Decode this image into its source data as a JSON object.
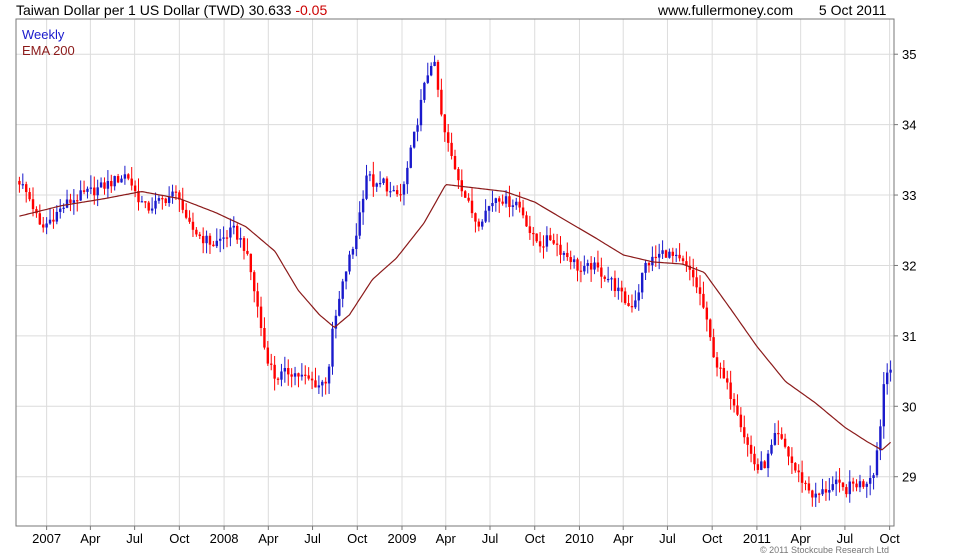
{
  "header": {
    "title": "Taiwan Dollar per 1 US Dollar (TWD)",
    "last_value": "30.633",
    "change": "-0.05",
    "site": "www.fullermoney.com",
    "date": "5 Oct 2011"
  },
  "legend": {
    "weekly": "Weekly",
    "ema": "EMA 200"
  },
  "copyright": "© 2011 Stockcube Research Ltd",
  "colors": {
    "up": "#1a1acc",
    "down": "#ff0000",
    "ema": "#8b1a1a",
    "grid": "#dcdcdc",
    "frame": "#777777"
  },
  "chart_data": {
    "type": "line",
    "title": "Taiwan Dollar per 1 US Dollar (TWD)",
    "frequency": "Weekly",
    "ylim": [
      28.3,
      35.5
    ],
    "y_ticks": [
      29,
      30,
      31,
      32,
      33,
      34,
      35
    ],
    "x_range": [
      "2006-10-30",
      "2011-10-10"
    ],
    "x_ticks": [
      {
        "label": "2007",
        "date": "2007-01-01"
      },
      {
        "label": "Apr",
        "date": "2007-04-01"
      },
      {
        "label": "Jul",
        "date": "2007-07-01"
      },
      {
        "label": "Oct",
        "date": "2007-10-01"
      },
      {
        "label": "2008",
        "date": "2008-01-01"
      },
      {
        "label": "Apr",
        "date": "2008-04-01"
      },
      {
        "label": "Jul",
        "date": "2008-07-01"
      },
      {
        "label": "Oct",
        "date": "2008-10-01"
      },
      {
        "label": "2009",
        "date": "2009-01-01"
      },
      {
        "label": "Apr",
        "date": "2009-04-01"
      },
      {
        "label": "Jul",
        "date": "2009-07-01"
      },
      {
        "label": "Oct",
        "date": "2009-10-01"
      },
      {
        "label": "2010",
        "date": "2010-01-01"
      },
      {
        "label": "Apr",
        "date": "2010-04-01"
      },
      {
        "label": "Jul",
        "date": "2010-07-01"
      },
      {
        "label": "Oct",
        "date": "2010-10-01"
      },
      {
        "label": "2011",
        "date": "2011-01-01"
      },
      {
        "label": "Apr",
        "date": "2011-04-01"
      },
      {
        "label": "Jul",
        "date": "2011-07-01"
      },
      {
        "label": "Oct",
        "date": "2011-10-01"
      }
    ],
    "series": [
      {
        "name": "Weekly",
        "style": "candles",
        "points": [
          [
            "2006-11-06",
            33.2
          ],
          [
            "2006-12-01",
            32.9
          ],
          [
            "2006-12-20",
            32.5
          ],
          [
            "2007-01-15",
            32.7
          ],
          [
            "2007-02-15",
            32.9
          ],
          [
            "2007-03-15",
            33.0
          ],
          [
            "2007-04-20",
            33.1
          ],
          [
            "2007-05-20",
            33.2
          ],
          [
            "2007-06-15",
            33.3
          ],
          [
            "2007-07-05",
            33.0
          ],
          [
            "2007-07-25",
            32.8
          ],
          [
            "2007-08-20",
            32.9
          ],
          [
            "2007-09-15",
            33.0
          ],
          [
            "2007-10-01",
            33.0
          ],
          [
            "2007-10-15",
            32.6
          ],
          [
            "2007-11-15",
            32.4
          ],
          [
            "2007-12-10",
            32.3
          ],
          [
            "2008-01-01",
            32.4
          ],
          [
            "2008-01-20",
            32.5
          ],
          [
            "2008-02-10",
            32.3
          ],
          [
            "2008-02-25",
            31.9
          ],
          [
            "2008-03-10",
            31.4
          ],
          [
            "2008-03-25",
            30.8
          ],
          [
            "2008-04-15",
            30.4
          ],
          [
            "2008-05-15",
            30.5
          ],
          [
            "2008-06-15",
            30.4
          ],
          [
            "2008-07-15",
            30.3
          ],
          [
            "2008-08-01",
            30.4
          ],
          [
            "2008-08-10",
            31.0
          ],
          [
            "2008-08-25",
            31.5
          ],
          [
            "2008-09-10",
            32.0
          ],
          [
            "2008-09-25",
            32.3
          ],
          [
            "2008-10-05",
            32.7
          ],
          [
            "2008-10-20",
            33.3
          ],
          [
            "2008-11-10",
            33.1
          ],
          [
            "2008-11-25",
            33.2
          ],
          [
            "2008-12-10",
            33.0
          ],
          [
            "2009-01-01",
            33.0
          ],
          [
            "2009-01-25",
            33.8
          ],
          [
            "2009-02-15",
            34.5
          ],
          [
            "2009-03-01",
            34.9
          ],
          [
            "2009-03-10",
            34.8
          ],
          [
            "2009-03-25",
            34.0
          ],
          [
            "2009-04-10",
            33.6
          ],
          [
            "2009-04-25",
            33.3
          ],
          [
            "2009-05-15",
            32.9
          ],
          [
            "2009-06-05",
            32.6
          ],
          [
            "2009-06-25",
            32.8
          ],
          [
            "2009-07-15",
            33.0
          ],
          [
            "2009-08-05",
            32.9
          ],
          [
            "2009-08-25",
            32.9
          ],
          [
            "2009-09-10",
            32.7
          ],
          [
            "2009-09-25",
            32.4
          ],
          [
            "2009-10-15",
            32.3
          ],
          [
            "2009-11-05",
            32.4
          ],
          [
            "2009-11-25",
            32.2
          ],
          [
            "2009-12-15",
            32.1
          ],
          [
            "2010-01-05",
            31.9
          ],
          [
            "2010-01-25",
            32.0
          ],
          [
            "2010-02-15",
            31.9
          ],
          [
            "2010-03-05",
            31.8
          ],
          [
            "2010-03-25",
            31.6
          ],
          [
            "2010-04-15",
            31.4
          ],
          [
            "2010-05-01",
            31.6
          ],
          [
            "2010-05-15",
            32.0
          ],
          [
            "2010-06-05",
            32.1
          ],
          [
            "2010-06-25",
            32.2
          ],
          [
            "2010-07-15",
            32.1
          ],
          [
            "2010-08-05",
            32.0
          ],
          [
            "2010-08-25",
            31.8
          ],
          [
            "2010-09-10",
            31.5
          ],
          [
            "2010-09-25",
            31.0
          ],
          [
            "2010-10-10",
            30.6
          ],
          [
            "2010-10-30",
            30.3
          ],
          [
            "2010-11-20",
            30.0
          ],
          [
            "2010-12-10",
            29.5
          ],
          [
            "2011-01-01",
            29.1
          ],
          [
            "2011-01-20",
            29.2
          ],
          [
            "2011-02-10",
            29.6
          ],
          [
            "2011-03-01",
            29.4
          ],
          [
            "2011-03-20",
            29.1
          ],
          [
            "2011-04-10",
            28.9
          ],
          [
            "2011-04-30",
            28.7
          ],
          [
            "2011-05-20",
            28.8
          ],
          [
            "2011-06-10",
            28.9
          ],
          [
            "2011-06-30",
            28.8
          ],
          [
            "2011-07-20",
            28.9
          ],
          [
            "2011-08-10",
            28.9
          ],
          [
            "2011-08-30",
            29.1
          ],
          [
            "2011-09-10",
            29.6
          ],
          [
            "2011-09-20",
            30.4
          ],
          [
            "2011-10-05",
            30.63
          ]
        ]
      },
      {
        "name": "EMA 200",
        "style": "line",
        "points": [
          [
            "2006-11-06",
            32.7
          ],
          [
            "2007-02-01",
            32.85
          ],
          [
            "2007-05-01",
            32.95
          ],
          [
            "2007-07-15",
            33.05
          ],
          [
            "2007-10-01",
            32.95
          ],
          [
            "2007-12-15",
            32.75
          ],
          [
            "2008-02-15",
            32.55
          ],
          [
            "2008-04-15",
            32.2
          ],
          [
            "2008-06-01",
            31.65
          ],
          [
            "2008-07-15",
            31.3
          ],
          [
            "2008-08-15",
            31.12
          ],
          [
            "2008-09-15",
            31.3
          ],
          [
            "2008-11-01",
            31.8
          ],
          [
            "2008-12-20",
            32.1
          ],
          [
            "2009-02-15",
            32.6
          ],
          [
            "2009-04-01",
            33.15
          ],
          [
            "2009-06-01",
            33.1
          ],
          [
            "2009-08-01",
            33.05
          ],
          [
            "2009-10-01",
            32.9
          ],
          [
            "2009-12-01",
            32.65
          ],
          [
            "2010-02-01",
            32.4
          ],
          [
            "2010-04-01",
            32.15
          ],
          [
            "2010-06-01",
            32.05
          ],
          [
            "2010-08-01",
            32.02
          ],
          [
            "2010-09-15",
            31.9
          ],
          [
            "2010-11-01",
            31.45
          ],
          [
            "2011-01-01",
            30.85
          ],
          [
            "2011-03-01",
            30.35
          ],
          [
            "2011-05-01",
            30.05
          ],
          [
            "2011-07-01",
            29.7
          ],
          [
            "2011-08-15",
            29.5
          ],
          [
            "2011-09-15",
            29.38
          ],
          [
            "2011-10-05",
            29.5
          ]
        ]
      }
    ],
    "grid": true,
    "legend_position": "top-left"
  }
}
